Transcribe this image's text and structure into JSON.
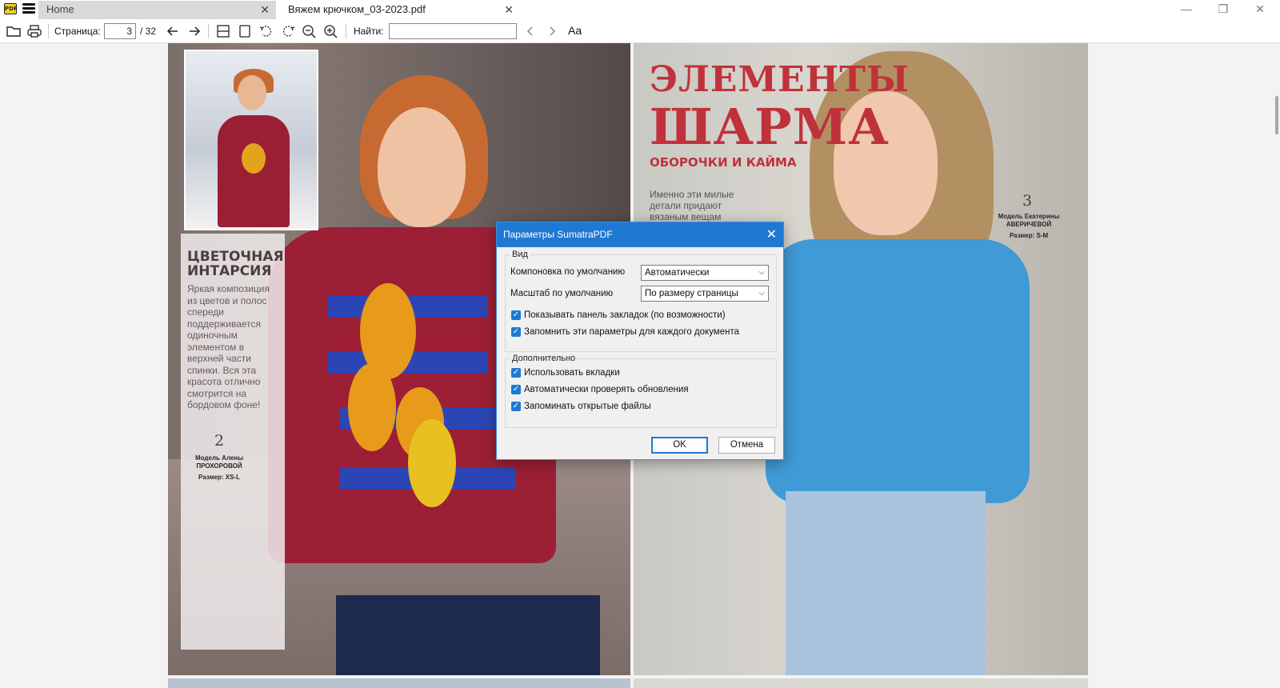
{
  "tabs": {
    "home_label": "Home",
    "doc_label": "Вяжем крючком_03-2023.pdf",
    "close_glyph": "✕"
  },
  "window_controls": {
    "minimize": "—",
    "maximize": "❐",
    "close": "✕"
  },
  "toolbar": {
    "page_label": "Страница:",
    "page_current": "3",
    "page_total": "/ 32",
    "find_label": "Найти:",
    "find_value": "",
    "icons": [
      "open-folder-icon",
      "print-icon",
      "back-arrow-icon",
      "forward-arrow-icon",
      "two-page-layout-icon",
      "single-page-icon",
      "rotate-left-icon",
      "rotate-right-icon",
      "zoom-out-icon",
      "zoom-in-icon",
      "find-prev-icon",
      "find-next-icon",
      "match-case-icon"
    ],
    "match_case_label": "Aa"
  },
  "pages": {
    "left": {
      "heading": "ЦВЕТОЧНАЯ ИНТАРСИЯ",
      "body": "Яркая композиция из цветов и полос спереди поддерживается одиночным элементом в верхней части спинки. Вся эта красота отлично смотрится на бордовом фоне!",
      "model_number": "2",
      "model_caption": "Модель Алены ПРОХОРОВОЙ",
      "size_caption": "Размер: XS-L"
    },
    "right": {
      "heading_line1": "ЭЛЕМЕНТЫ",
      "heading_line2": "ШАРМА",
      "subheading": "ОБОРОЧКИ И КАЙМА",
      "body": "Именно эти милые детали придают вязаным вещам",
      "model_number": "3",
      "model_caption": "Модель Екатерины АВЕРИЧЕВОЙ",
      "size_caption": "Размер: S-M"
    }
  },
  "dialog": {
    "title": "Параметры SumatraPDF",
    "close_glyph": "✕",
    "view_group": {
      "label": "Вид",
      "layout_label": "Компоновка по умолчанию",
      "layout_value": "Автоматически",
      "zoom_label": "Масштаб по умолчанию",
      "zoom_value": "По размеру страницы",
      "checkboxes": [
        {
          "label": "Показывать панель закладок (по возможности)",
          "checked": true
        },
        {
          "label": "Запомнить эти параметры для каждого документа",
          "checked": true
        }
      ]
    },
    "advanced_group": {
      "label": "Дополнительно",
      "checkboxes": [
        {
          "label": "Использовать вкладки",
          "checked": true
        },
        {
          "label": "Автоматически проверять обновления",
          "checked": true
        },
        {
          "label": "Запоминать открытые файлы",
          "checked": true
        }
      ]
    },
    "ok_label": "OK",
    "cancel_label": "Отмена"
  },
  "colors": {
    "accent": "#1f79d2",
    "magazine_red": "#c0323b"
  }
}
